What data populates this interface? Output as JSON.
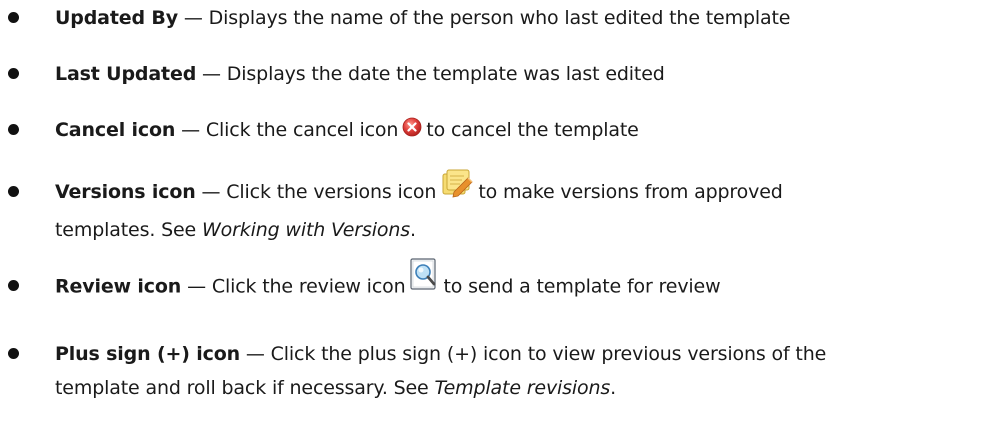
{
  "items": [
    {
      "term": "Updated By",
      "dash": " — ",
      "text": "Displays the name of the person who last edited the template"
    },
    {
      "term": "Last Updated",
      "dash": " — ",
      "text": "Displays the date the template was last edited"
    },
    {
      "term": "Cancel icon",
      "dash": " — ",
      "text_before": "Click the cancel icon",
      "icon": "cancel-icon",
      "text_after": "to cancel the template"
    },
    {
      "term": "Versions icon",
      "dash": " — ",
      "text_before": "Click the versions icon",
      "icon": "versions-icon",
      "text_after": "to make versions from approved",
      "line2_text": "templates. See ",
      "line2_italic": "Working with Versions",
      "line2_end": "."
    },
    {
      "term": "Review icon",
      "dash": " — ",
      "text_before": "Click the review icon",
      "icon": "review-icon",
      "text_after": "to send a template for review"
    },
    {
      "term": "Plus sign (+) icon",
      "dash": " — ",
      "text": "Click the plus sign (+) icon to view previous versions of the",
      "line2_text": "template and roll back if necessary. See ",
      "line2_italic": "Template revisions",
      "line2_end": "."
    }
  ],
  "colors": {
    "text": "#1a1a1a",
    "cancel_icon_red": "#e0403c",
    "versions_icon_yellow": "#f4d35a",
    "versions_pencil_orange": "#e8912c",
    "review_icon_blue": "#4a9fd8"
  }
}
